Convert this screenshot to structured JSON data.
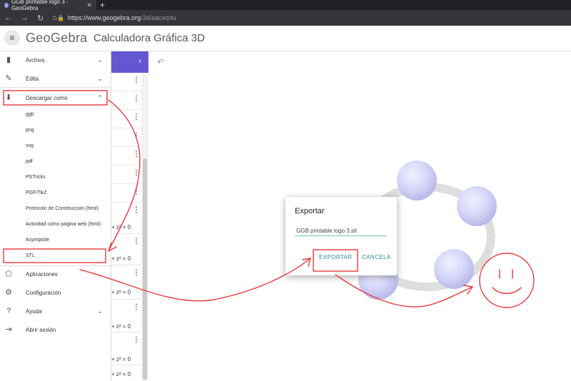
{
  "browser": {
    "tab_title": "GGB printable logo 3 - GeoGebra",
    "tab_close": "✕",
    "new_tab": "+",
    "url_host": "https://www.geogebra.org",
    "url_path": "/3d/aacxrptu"
  },
  "header": {
    "brand": "GeoGebra",
    "title": "Calculadora Gráfica 3D"
  },
  "menu": {
    "items": [
      {
        "label": "Archivo"
      },
      {
        "label": "Edita"
      },
      {
        "label": "Descargar como"
      },
      {
        "label": "Aplicaciones"
      },
      {
        "label": "Configuración"
      },
      {
        "label": "Ayuda"
      },
      {
        "label": "Abrir sesión"
      }
    ],
    "download_options": [
      "ggb",
      "png",
      "svg",
      "pdf",
      "PSTricks",
      "PGF/TikZ",
      "Protocolo de Construcción (html)",
      "Actividad como página web (html)",
      "Asymptote",
      "STL"
    ]
  },
  "algebra": {
    "equations": [
      "+ z² = 0",
      "+ z² = 0",
      "+ z² = 0",
      "+ z² = 0",
      "+ z² = 0",
      "+ z² = 0"
    ]
  },
  "dialog": {
    "title": "Exportar",
    "filename": "GGB printable logo 3.stl",
    "export_label": "EXPORTAR",
    "cancel_label": "CANCELA"
  },
  "colors": {
    "accent": "#6557d2",
    "dialog_button": "#2a8d86",
    "annotation": "#e8383b"
  }
}
